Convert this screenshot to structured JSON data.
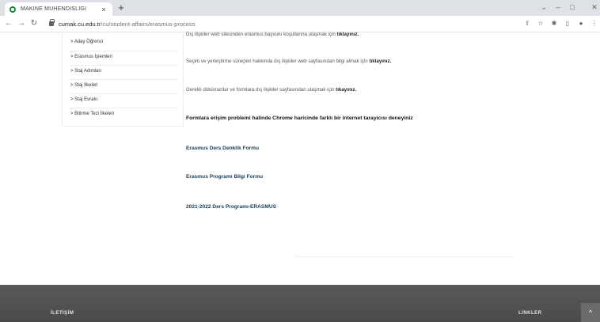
{
  "browser": {
    "tab_title": "MAKİNE MÜHENDİSLİĞİ",
    "tab_close": "×",
    "new_tab": "+",
    "url_host": "cumak.cu.edu.tr",
    "url_path": "/cu/student-affairs/erasmus-process",
    "icons": [
      "back-arrow-icon",
      "forward-arrow-icon",
      "reload-icon",
      "lock-icon",
      "share-icon",
      "star-icon",
      "extensions-icon",
      "sidebar-icon",
      "profile-icon",
      "menu-icon"
    ],
    "window_controls": {
      "chevron": "⌄",
      "minimize": "–",
      "maximize": "□",
      "close": "✕"
    }
  },
  "sidebar": {
    "items": [
      {
        "label": "> Aday Öğrenci"
      },
      {
        "label": "> Erasmus İşlemleri"
      },
      {
        "label": "> Staj Adımları"
      },
      {
        "label": "> Staj İlkeleri"
      },
      {
        "label": "> Staj Evrakı"
      },
      {
        "label": "> Bitirme Tezi İlkeleri"
      }
    ]
  },
  "content": {
    "lines": [
      {
        "text": "Dış ilişkiler web sitesinden erasmus başvuru koşullarına ulaşmak için ",
        "link": "tıklayınız."
      },
      {
        "text": "Seçim ve yerleştirme süreçleri hakkında dış ilişkiler web sayfasından bilgi almak için ",
        "link": "tıklayınız."
      },
      {
        "text": "Gerekli dökümanlar ve formlara dış ilişkiler sayfasından ulaşmak için ",
        "link": "tıkayınız."
      }
    ],
    "notice": "Formlara erişim problemi halinde Chrome haricinde farklı bir internet tarayıcısı deneyiniz",
    "form_links": [
      {
        "label": "Erasmus Ders Denklik Formu"
      },
      {
        "label": "Erasmus Programı Bilgi Formu"
      },
      {
        "label": "2021-2022 Ders Programı-ERASMUS"
      }
    ]
  },
  "footer": {
    "contact_label": "İLETİŞİM",
    "links_label": "LİNKLER",
    "to_top": "^"
  }
}
